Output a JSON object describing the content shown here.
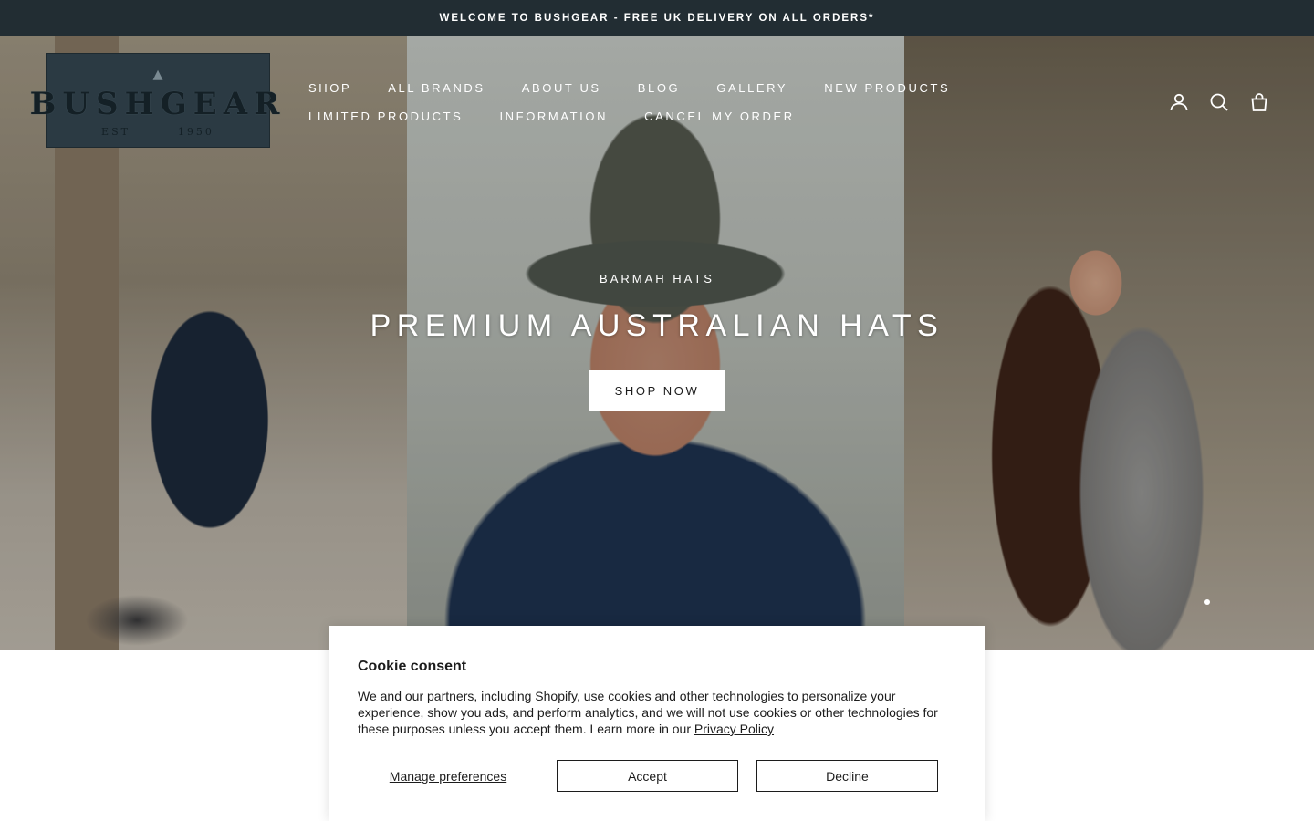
{
  "announcement": {
    "text": "WELCOME TO BUSHGEAR - FREE UK DELIVERY ON ALL ORDERS*"
  },
  "logo": {
    "text": "BUSHGEAR",
    "est": "EST",
    "year": "1950"
  },
  "nav": {
    "items": [
      {
        "label": "SHOP"
      },
      {
        "label": "ALL BRANDS"
      },
      {
        "label": "ABOUT US"
      },
      {
        "label": "BLOG"
      },
      {
        "label": "GALLERY"
      },
      {
        "label": "NEW PRODUCTS"
      },
      {
        "label": "LIMITED PRODUCTS"
      },
      {
        "label": "INFORMATION"
      },
      {
        "label": "CANCEL MY ORDER"
      }
    ]
  },
  "header_icons": [
    "account-icon",
    "search-icon",
    "cart-bag-icon"
  ],
  "hero": {
    "subtitle": "BARMAH HATS",
    "title": "PREMIUM AUSTRALIAN HATS",
    "button": "SHOP NOW"
  },
  "cookie": {
    "title": "Cookie consent",
    "body": "We and our partners, including Shopify, use cookies and other technologies to personalize your experience, show you ads, and perform analytics, and we will not use cookies or other technologies for these purposes unless you accept them. Learn more in our ",
    "privacy_link": "Privacy Policy",
    "manage": "Manage preferences",
    "accept": "Accept",
    "decline": "Decline"
  },
  "colors": {
    "announcement_bg": "#222d33",
    "logo_bg": "#2b3a43",
    "text": "#1c1c1c"
  }
}
